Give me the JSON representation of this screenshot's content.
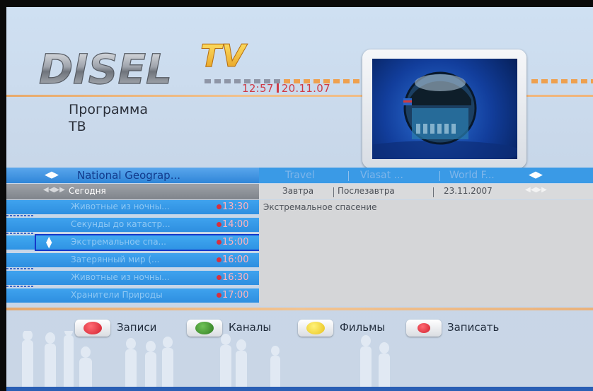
{
  "header": {
    "logo_text": "DISEL",
    "logo_tv": "TV",
    "clock_time": "12:57",
    "clock_date": "20.11.07",
    "title_line1": "Программа",
    "title_line2": "ТВ"
  },
  "channels": {
    "current": "National Geograp...",
    "others": [
      "Travel",
      "Viasat ...",
      "World F..."
    ]
  },
  "days": {
    "current": "Сегодня",
    "others": [
      "Завтра",
      "Послезавтра",
      "23.11.2007"
    ]
  },
  "programs": [
    {
      "title": "Животные из ночны...",
      "time": "13:30",
      "selected": false
    },
    {
      "title": "Секунды до катастр...",
      "time": "14:00",
      "selected": false
    },
    {
      "title": "Экстремальное спа...",
      "time": "15:00",
      "selected": true
    },
    {
      "title": "Затерянный мир (...",
      "time": "16:00",
      "selected": false
    },
    {
      "title": "Животные из ночны...",
      "time": "16:30",
      "selected": false
    },
    {
      "title": "Хранители Природы",
      "time": "17:00",
      "selected": false
    }
  ],
  "details": {
    "description": "Экстремальное спасение"
  },
  "legend": [
    {
      "label": "Записи",
      "color": "#e4323f"
    },
    {
      "label": "Каналы",
      "color": "#3d8b2a"
    },
    {
      "label": "Фильмы",
      "color": "#f2d42d"
    },
    {
      "label": "Записать",
      "color": "#e4323f"
    }
  ],
  "icons": {
    "channel_arrows": "left-right-arrows-icon",
    "day_arrows": "double-arrows-icon",
    "updown": "up-down-arrows-icon",
    "record_dot": "record-dot-icon"
  }
}
